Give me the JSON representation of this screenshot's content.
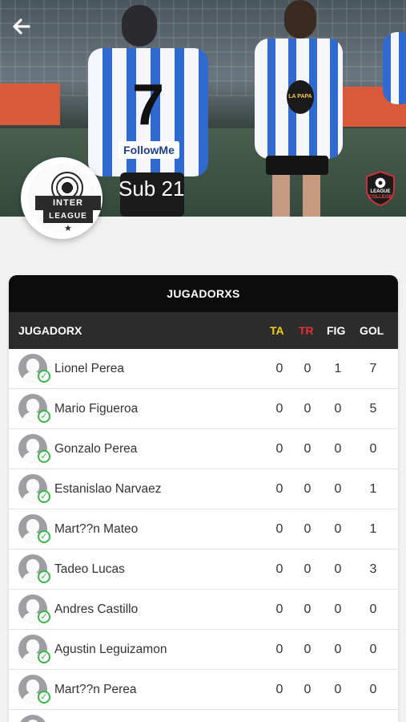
{
  "header": {
    "category": "Sub 21"
  },
  "league_logo": {
    "line1": "INTER",
    "line2": "LEAGUE"
  },
  "college_badge": {
    "line1": "LEAGUE",
    "line2": "COLLEGE"
  },
  "hero_text": {
    "jersey_number": "7",
    "jersey_sponsor": "FollowMe",
    "crest_text": "LA PAPA"
  },
  "table": {
    "title": "JUGADORXS",
    "columns": {
      "name": "JUGADORX",
      "ta": "TA",
      "tr": "TR",
      "fig": "FIG",
      "gol": "GOL"
    },
    "rows": [
      {
        "name": "Lionel Perea",
        "ta": "0",
        "tr": "0",
        "fig": "1",
        "gol": "7"
      },
      {
        "name": "Mario Figueroa",
        "ta": "0",
        "tr": "0",
        "fig": "0",
        "gol": "5"
      },
      {
        "name": "Gonzalo Perea",
        "ta": "0",
        "tr": "0",
        "fig": "0",
        "gol": "0"
      },
      {
        "name": "Estanislao Narvaez",
        "ta": "0",
        "tr": "0",
        "fig": "0",
        "gol": "1"
      },
      {
        "name": "Mart??n Mateo",
        "ta": "0",
        "tr": "0",
        "fig": "0",
        "gol": "1"
      },
      {
        "name": "Tadeo Lucas",
        "ta": "0",
        "tr": "0",
        "fig": "0",
        "gol": "3"
      },
      {
        "name": "Andres Castillo",
        "ta": "0",
        "tr": "0",
        "fig": "0",
        "gol": "0"
      },
      {
        "name": "Agustin Leguizamon",
        "ta": "0",
        "tr": "0",
        "fig": "0",
        "gol": "0"
      },
      {
        "name": "Mart??n Perea",
        "ta": "0",
        "tr": "0",
        "fig": "0",
        "gol": "0"
      },
      {
        "name": "",
        "ta": "",
        "tr": "",
        "fig": "",
        "gol": ""
      }
    ]
  },
  "colors": {
    "ta": "#f3cf16",
    "tr": "#e23131",
    "check": "#3bb54a",
    "panel_title_bg": "#0c0c0c",
    "header_bg": "#2c2c2c"
  }
}
